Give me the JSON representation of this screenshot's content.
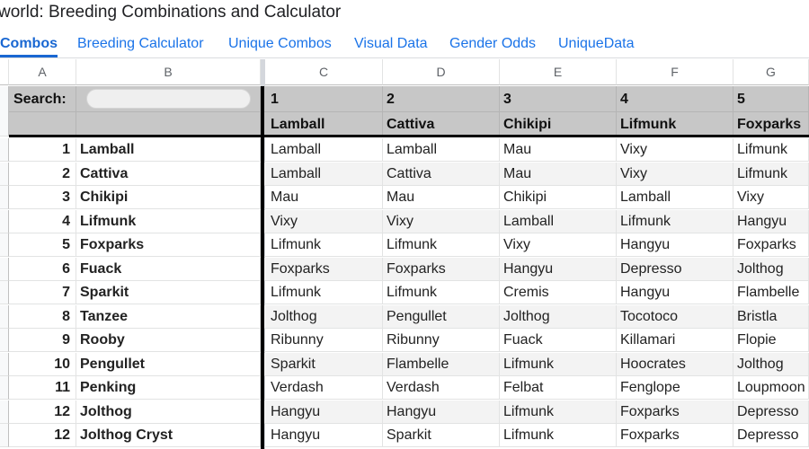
{
  "title": "world: Breeding Combinations and Calculator",
  "tabs": [
    "Combos",
    "Breeding Calculator",
    "Unique Combos",
    "Visual Data",
    "Gender Odds",
    "UniqueData"
  ],
  "column_letters": [
    "A",
    "B",
    "C",
    "D",
    "E",
    "F",
    "G"
  ],
  "search_label": "Search:",
  "header_numbers": [
    "1",
    "2",
    "3",
    "4",
    "5"
  ],
  "header_names": [
    "Lamball",
    "Cattiva",
    "Chikipi",
    "Lifmunk",
    "Foxparks"
  ],
  "rows": [
    {
      "num": "1",
      "name": "Lamball",
      "cells": [
        "Lamball",
        "Lamball",
        "Mau",
        "Vixy",
        "Lifmunk"
      ]
    },
    {
      "num": "2",
      "name": "Cattiva",
      "cells": [
        "Lamball",
        "Cattiva",
        "Mau",
        "Vixy",
        "Lifmunk"
      ]
    },
    {
      "num": "3",
      "name": "Chikipi",
      "cells": [
        "Mau",
        "Mau",
        "Chikipi",
        "Lamball",
        "Vixy"
      ]
    },
    {
      "num": "4",
      "name": "Lifmunk",
      "cells": [
        "Vixy",
        "Vixy",
        "Lamball",
        "Lifmunk",
        "Hangyu"
      ]
    },
    {
      "num": "5",
      "name": "Foxparks",
      "cells": [
        "Lifmunk",
        "Lifmunk",
        "Vixy",
        "Hangyu",
        "Foxparks"
      ]
    },
    {
      "num": "6",
      "name": "Fuack",
      "cells": [
        "Foxparks",
        "Foxparks",
        "Hangyu",
        "Depresso",
        "Jolthog"
      ]
    },
    {
      "num": "7",
      "name": "Sparkit",
      "cells": [
        "Lifmunk",
        "Lifmunk",
        "Cremis",
        "Hangyu",
        "Flambelle"
      ]
    },
    {
      "num": "8",
      "name": "Tanzee",
      "cells": [
        "Jolthog",
        "Pengullet",
        "Jolthog",
        "Tocotoco",
        "Bristla"
      ]
    },
    {
      "num": "9",
      "name": "Rooby",
      "cells": [
        "Ribunny",
        "Ribunny",
        "Fuack",
        "Killamari",
        "Flopie"
      ]
    },
    {
      "num": "10",
      "name": "Pengullet",
      "cells": [
        "Sparkit",
        "Flambelle",
        "Lifmunk",
        "Hoocrates",
        "Jolthog"
      ]
    },
    {
      "num": "11",
      "name": "Penking",
      "cells": [
        "Verdash",
        "Verdash",
        "Felbat",
        "Fenglope",
        "Loupmoon"
      ]
    },
    {
      "num": "12",
      "name": "Jolthog",
      "cells": [
        "Hangyu",
        "Hangyu",
        "Lifmunk",
        "Foxparks",
        "Depresso"
      ]
    },
    {
      "num": "12",
      "name": "Jolthog Cryst",
      "cells": [
        "Hangyu",
        "Sparkit",
        "Lifmunk",
        "Foxparks",
        "Depresso"
      ]
    }
  ]
}
